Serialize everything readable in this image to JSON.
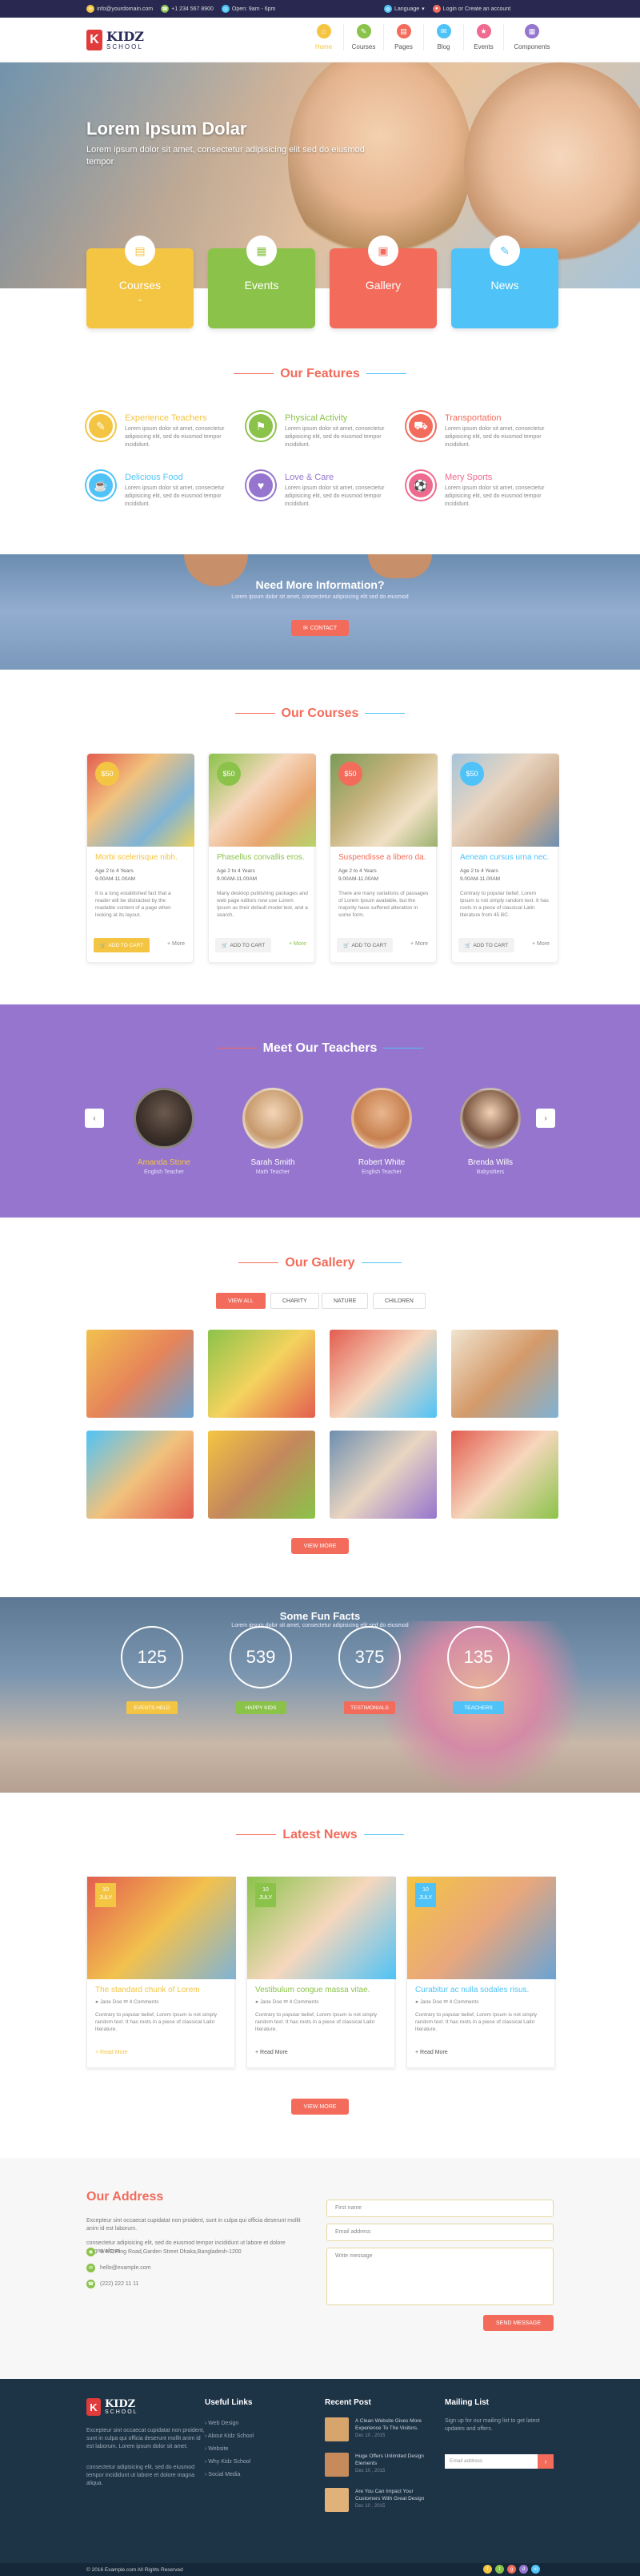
{
  "topbar": {
    "email": "info@yourdomain.com",
    "phone": "+1 234 567 8900",
    "hours": "Open: 9am - 6pm",
    "language": "Language",
    "login": "Login",
    "or": "or",
    "create": "Create an account"
  },
  "logo": {
    "line1": "KIDZ",
    "line2": "SCHOOL"
  },
  "nav": [
    {
      "label": "Home",
      "color": "#f4c542"
    },
    {
      "label": "Courses",
      "color": "#8bc34a"
    },
    {
      "label": "Pages",
      "color": "#f26b5b"
    },
    {
      "label": "Blog",
      "color": "#4fc3f7"
    },
    {
      "label": "Events",
      "color": "#ef6a8f"
    },
    {
      "label": "Components",
      "color": "#9575cd"
    }
  ],
  "hero": {
    "title": "Lorem Ipsum Dolar",
    "text": "Lorem ipsum dolor sit amet, consectetur adipisicing elit sed do eiusmod tempor"
  },
  "cards": [
    {
      "label": "Courses",
      "color": "#f4c542"
    },
    {
      "label": "Events",
      "color": "#8bc34a"
    },
    {
      "label": "Gallery",
      "color": "#f26b5b"
    },
    {
      "label": "News",
      "color": "#4fc3f7"
    }
  ],
  "features": {
    "title": "Our Features",
    "items": [
      {
        "title": "Experience Teachers",
        "text": "Lorem ipsum dolor sit amet, consectetur adipisicing elit, sed do eiusmod tempor incididunt.",
        "color": "#f4c542"
      },
      {
        "title": "Physical Activity",
        "text": "Lorem ipsum dolor sit amet, consectetur adipisicing elit, sed do eiusmod tempor incididunt.",
        "color": "#8bc34a"
      },
      {
        "title": "Transportation",
        "text": "Lorem ipsum dolor sit amet, consectetur adipisicing elit, sed do eiusmod tempor incididunt.",
        "color": "#f26b5b"
      },
      {
        "title": "Delicious Food",
        "text": "Lorem ipsum dolor sit amet, consectetur adipisicing elit, sed do eiusmod tempor incididunt.",
        "color": "#4fc3f7"
      },
      {
        "title": "Love & Care",
        "text": "Lorem ipsum dolor sit amet, consectetur adipisicing elit, sed do eiusmod tempor incididunt.",
        "color": "#9575cd"
      },
      {
        "title": "Mery Sports",
        "text": "Lorem ipsum dolor sit amet, consectetur adipisicing elit, sed do eiusmod tempor incididunt.",
        "color": "#ef6a8f"
      }
    ]
  },
  "info": {
    "title": "Need More Information?",
    "text": "Lorem ipsum dolor sit amet, consectetur adipisicing elit sed do eiusmod",
    "button": "CONTACT"
  },
  "courses": {
    "title": "Our Courses",
    "items": [
      {
        "price": "$50",
        "title": "Morbi scelerisque nibh.",
        "age": "Age 2 to 4 Years",
        "time": "9.00AM-11.00AM",
        "text": "It is a long established fact that a reader will be distracted by the readable content of a page when looking at its layout.",
        "btn": "ADD TO CART",
        "more": "More",
        "color": "#f4c542"
      },
      {
        "price": "$50",
        "title": "Phasellus convallis eros.",
        "age": "Age 2 to 4 Years",
        "time": "9.00AM-11.00AM",
        "text": "Many desktop publishing packages and web page editors now use Lorem Ipsum as their default model text, and a search.",
        "btn": "ADD TO CART",
        "more": "More",
        "color": "#8bc34a"
      },
      {
        "price": "$50",
        "title": "Suspendisse a libero da.",
        "age": "Age 2 to 4 Years",
        "time": "9.00AM-11.00AM",
        "text": "There are many variations of passages of Lorem Ipsum available, but the majority have suffered alteration in some form.",
        "btn": "ADD TO CART",
        "more": "More",
        "color": "#f26b5b"
      },
      {
        "price": "$50",
        "title": "Aenean cursus urna nec.",
        "age": "Age 2 to 4 Years",
        "time": "9.00AM-11.00AM",
        "text": "Contrary to popular belief, Lorem Ipsum is not simply random text. It has roots in a piece of classical Latin literature from 45 BC.",
        "btn": "ADD TO CART",
        "more": "More",
        "color": "#4fc3f7"
      }
    ]
  },
  "teachers": {
    "title": "Meet Our Teachers",
    "items": [
      {
        "name": "Amanda Stone",
        "role": "English Teacher"
      },
      {
        "name": "Sarah Smith",
        "role": "Math Teacher"
      },
      {
        "name": "Robert White",
        "role": "English Teacher"
      },
      {
        "name": "Brenda Wills",
        "role": "Babysitters"
      }
    ]
  },
  "gallery": {
    "title": "Our Gallery",
    "filters": [
      "VIEW ALL",
      "CHARITY",
      "NATURE",
      "CHILDREN"
    ],
    "button": "VIEW MORE"
  },
  "facts": {
    "title": "Some Fun Facts",
    "text": "Lorem ipsum dolor sit amet, consectetur adipisicing elit sed do eiusmod",
    "items": [
      {
        "value": "125",
        "label": "EVENTS HELD",
        "color": "#f4c542"
      },
      {
        "value": "539",
        "label": "HAPPY KIDS",
        "color": "#8bc34a"
      },
      {
        "value": "375",
        "label": "TESTIMONIALS",
        "color": "#f26b5b"
      },
      {
        "value": "135",
        "label": "TEACHERS",
        "color": "#4fc3f7"
      }
    ]
  },
  "news": {
    "title": "Latest News",
    "button": "VIEW MORE",
    "items": [
      {
        "day": "10",
        "month": "JULY",
        "title": "The standard chunk of Lorem",
        "author": "Jane Doe",
        "comments": "4 Comments",
        "text": "Contrary to popular belief, Lorem Ipsum is not simply random text. It has roots in a piece of classical Latin literature.",
        "more": "Read More",
        "color": "#f4c542"
      },
      {
        "day": "10",
        "month": "JULY",
        "title": "Vestibulum congue massa vitae.",
        "author": "Jane Doe",
        "comments": "4 Comments",
        "text": "Contrary to popular belief, Lorem Ipsum is not simply random text. It has roots in a piece of classical Latin literature.",
        "more": "Read More",
        "color": "#8bc34a"
      },
      {
        "day": "10",
        "month": "JULY",
        "title": "Curabitur ac nulla sodales risus.",
        "author": "Jane Doe",
        "comments": "4 Comments",
        "text": "Contrary to popular belief, Lorem Ipsum is not simply random text. It has roots in a piece of classical Latin literature.",
        "more": "Read More",
        "color": "#4fc3f7"
      }
    ]
  },
  "contact": {
    "title": "Our Address",
    "text1": "Excepteur sint occaecat cupidatat non proident, sunt in culpa qui officia deserunt mollit anim id est laborum.",
    "text2": "consectetur adipisicing elit, sed do eiusmod tempor incididunt ut labore et dolore magna aliqua.",
    "address": "9/4/C Ring Road,Garden Street Dhaka,Bangladesh-1200",
    "email": "hello@example.com",
    "phone": "(222) 222 11 11",
    "first_name": "First name",
    "email_ph": "Email address",
    "message": "Write message",
    "send": "SEND MESSAGE"
  },
  "footer": {
    "about": "Excepteur sint occaecat cupidatat non proident, sunt in culpa qui officia deserunt mollit anim id est laborum. Lorem ipsum dolor sit amet.",
    "about2": "consectetur adipisicing elit, sed do eiusmod tempor incididunt ut labore et dolore magna aliqua.",
    "links_title": "Useful Links",
    "links": [
      "Web Design",
      "About Kidz School",
      "Website",
      "Why Kidz School",
      "Social Media"
    ],
    "recent_title": "Recent Post",
    "posts": [
      {
        "title": "A Clean Website Gives More Experience To The Visitors.",
        "date": "Dec 10 , 2015"
      },
      {
        "title": "Huge Offers Unlimited Design Elements",
        "date": "Dec 10 , 2015"
      },
      {
        "title": "Are You Can Impact Your Customers With Great Design",
        "date": "Dec 10 , 2015"
      }
    ],
    "mail_title": "Mailing List",
    "mail_text": "Sign up for our mailing list to get latest updates and offers.",
    "mail_ph": "Email address",
    "copyright": "© 2016 Example.com All Rights Reserved"
  }
}
